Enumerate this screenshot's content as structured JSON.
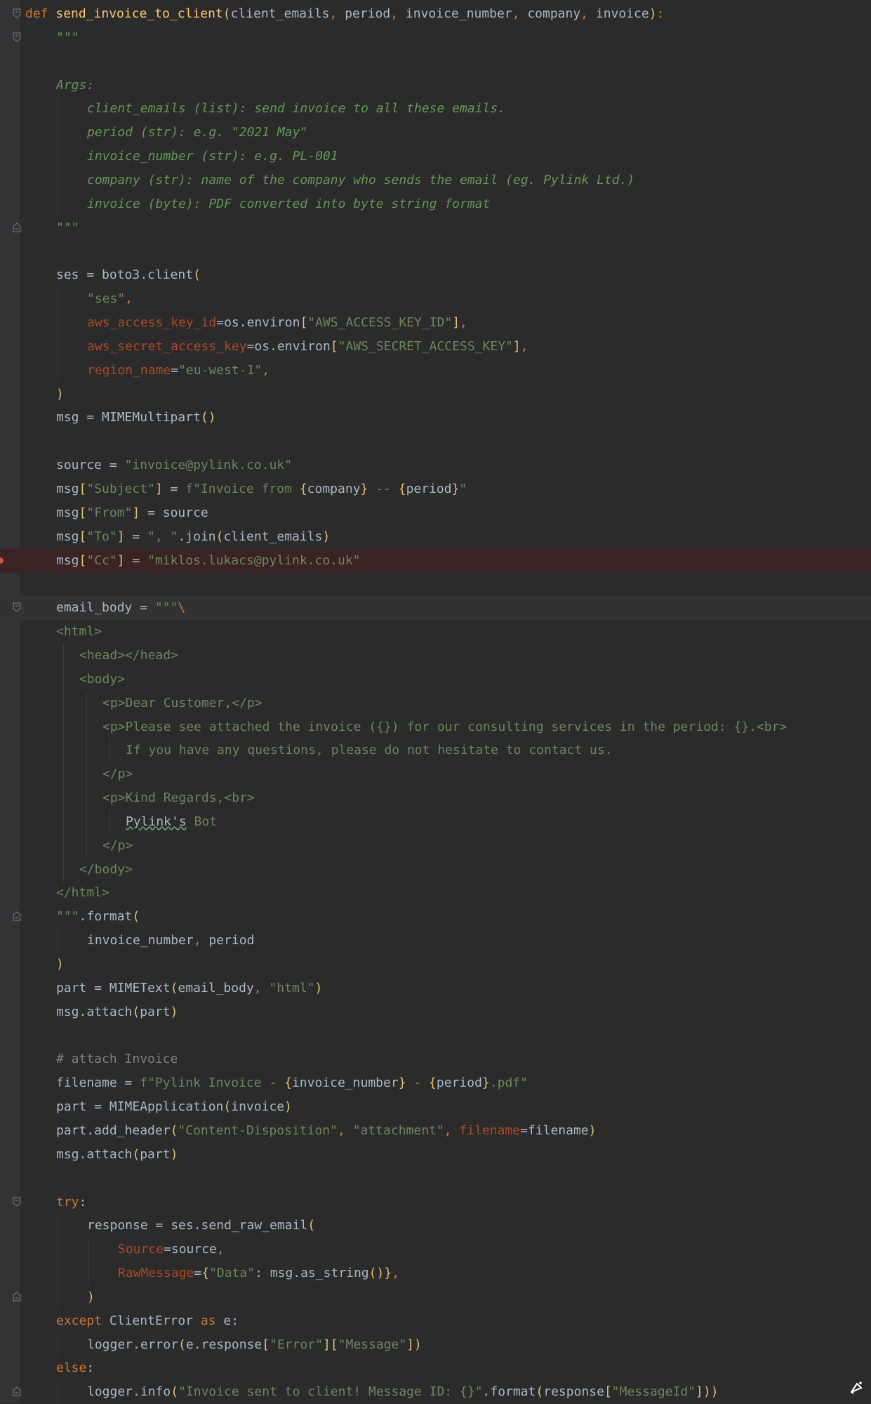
{
  "editor": {
    "language": "python",
    "breakpoint_line": 23,
    "current_line": 25,
    "colors": {
      "background": "#2b2b2b",
      "gutter": "#313335",
      "keyword": "#cc7832",
      "function": "#ffc66d",
      "string": "#6a8759",
      "docstring": "#629755",
      "parameter": "#aa4926",
      "comment": "#808080",
      "breakpoint": "#c75450"
    }
  },
  "code_lines": [
    {
      "indent": 0,
      "fold": "open",
      "tokens": [
        [
          "kw",
          "def "
        ],
        [
          "fn",
          "send_invoice_to_client"
        ],
        [
          "br",
          "("
        ],
        [
          "pl",
          "client_emails"
        ],
        [
          "kw",
          ", "
        ],
        [
          "pl",
          "period"
        ],
        [
          "kw",
          ", "
        ],
        [
          "pl",
          "invoice_number"
        ],
        [
          "kw",
          ", "
        ],
        [
          "pl",
          "company"
        ],
        [
          "kw",
          ", "
        ],
        [
          "pl",
          "invoice"
        ],
        [
          "br",
          ")"
        ],
        [
          "kw",
          ":"
        ]
      ]
    },
    {
      "indent": 1,
      "fold": "open",
      "tokens": [
        [
          "doc",
          "\"\"\""
        ]
      ]
    },
    {
      "indent": 0,
      "tokens": []
    },
    {
      "indent": 1,
      "tokens": [
        [
          "doc",
          "Args:"
        ]
      ]
    },
    {
      "indent": 2,
      "tokens": [
        [
          "doc",
          "client_emails (list): send invoice to all these emails."
        ]
      ]
    },
    {
      "indent": 2,
      "tokens": [
        [
          "doc",
          "period (str): e.g. \"2021 May\""
        ]
      ]
    },
    {
      "indent": 2,
      "tokens": [
        [
          "doc",
          "invoice_number (str): e.g. PL-001"
        ]
      ]
    },
    {
      "indent": 2,
      "tokens": [
        [
          "doc",
          "company (str): name of the company who sends the email (eg. Pylink Ltd.)"
        ]
      ]
    },
    {
      "indent": 2,
      "tokens": [
        [
          "doc",
          "invoice (byte): PDF converted into byte string format"
        ]
      ]
    },
    {
      "indent": 1,
      "fold": "close",
      "tokens": [
        [
          "doc",
          "\"\"\""
        ]
      ]
    },
    {
      "indent": 0,
      "tokens": []
    },
    {
      "indent": 1,
      "tokens": [
        [
          "pl",
          "ses = boto3.client"
        ],
        [
          "br",
          "("
        ]
      ]
    },
    {
      "indent": 2,
      "tokens": [
        [
          "str",
          "\"ses\""
        ],
        [
          "kw",
          ","
        ]
      ]
    },
    {
      "indent": 2,
      "tokens": [
        [
          "param",
          "aws_access_key_id"
        ],
        [
          "op",
          "=os.environ"
        ],
        [
          "br",
          "["
        ],
        [
          "str",
          "\"AWS_ACCESS_KEY_ID\""
        ],
        [
          "br",
          "]"
        ],
        [
          "kw",
          ","
        ]
      ]
    },
    {
      "indent": 2,
      "tokens": [
        [
          "param",
          "aws_secret_access_key"
        ],
        [
          "op",
          "=os.environ"
        ],
        [
          "br",
          "["
        ],
        [
          "str",
          "\"AWS_SECRET_ACCESS_KEY\""
        ],
        [
          "br",
          "]"
        ],
        [
          "kw",
          ","
        ]
      ]
    },
    {
      "indent": 2,
      "tokens": [
        [
          "param",
          "region_name"
        ],
        [
          "op",
          "="
        ],
        [
          "str",
          "\"eu-west-1\""
        ],
        [
          "kw",
          ","
        ]
      ]
    },
    {
      "indent": 1,
      "tokens": [
        [
          "br",
          ")"
        ]
      ]
    },
    {
      "indent": 1,
      "tokens": [
        [
          "pl",
          "msg = MIMEMultipart"
        ],
        [
          "br",
          "()"
        ]
      ]
    },
    {
      "indent": 0,
      "tokens": []
    },
    {
      "indent": 1,
      "tokens": [
        [
          "pl",
          "source = "
        ],
        [
          "str",
          "\"invoice@pylink.co.uk\""
        ]
      ]
    },
    {
      "indent": 1,
      "tokens": [
        [
          "pl",
          "msg"
        ],
        [
          "br",
          "["
        ],
        [
          "str",
          "\"Subject\""
        ],
        [
          "br",
          "]"
        ],
        [
          "pl",
          " = "
        ],
        [
          "str",
          "f\"Invoice from "
        ],
        [
          "br",
          "{"
        ],
        [
          "pl",
          "company"
        ],
        [
          "br",
          "}"
        ],
        [
          "str",
          " -- "
        ],
        [
          "br",
          "{"
        ],
        [
          "pl",
          "period"
        ],
        [
          "br",
          "}"
        ],
        [
          "str",
          "\""
        ]
      ]
    },
    {
      "indent": 1,
      "tokens": [
        [
          "pl",
          "msg"
        ],
        [
          "br",
          "["
        ],
        [
          "str",
          "\"From\""
        ],
        [
          "br",
          "]"
        ],
        [
          "pl",
          " = source"
        ]
      ]
    },
    {
      "indent": 1,
      "tokens": [
        [
          "pl",
          "msg"
        ],
        [
          "br",
          "["
        ],
        [
          "str",
          "\"To\""
        ],
        [
          "br",
          "]"
        ],
        [
          "pl",
          " = "
        ],
        [
          "str",
          "\", \""
        ],
        [
          "pl",
          ".join"
        ],
        [
          "br",
          "("
        ],
        [
          "pl",
          "client_emails"
        ],
        [
          "br",
          ")"
        ]
      ]
    },
    {
      "indent": 1,
      "tokens": [
        [
          "pl",
          "msg"
        ],
        [
          "br",
          "["
        ],
        [
          "str",
          "\"Cc\""
        ],
        [
          "br",
          "]"
        ],
        [
          "pl",
          " = "
        ],
        [
          "str",
          "\"miklos.lukacs@pylink.co.uk\""
        ]
      ]
    },
    {
      "indent": 0,
      "tokens": []
    },
    {
      "indent": 1,
      "fold": "open",
      "tokens": [
        [
          "pl",
          "email_body = "
        ],
        [
          "str",
          "\"\"\""
        ],
        [
          "esc",
          "\\"
        ]
      ]
    },
    {
      "indent": 1,
      "tokens": [
        [
          "str",
          "<html>"
        ]
      ]
    },
    {
      "indent": 1,
      "sub": 1,
      "tokens": [
        [
          "str",
          "<head></head>"
        ]
      ]
    },
    {
      "indent": 1,
      "sub": 1,
      "tokens": [
        [
          "str",
          "<body>"
        ]
      ]
    },
    {
      "indent": 1,
      "sub": 2,
      "tokens": [
        [
          "str",
          "<p>Dear Customer,</p>"
        ]
      ]
    },
    {
      "indent": 1,
      "sub": 2,
      "tokens": [
        [
          "str",
          "<p>Please see attached the invoice ({}) for our consulting services in the period: {}.<br>"
        ]
      ]
    },
    {
      "indent": 1,
      "sub": 3,
      "tokens": [
        [
          "str",
          "If you have any questions, please do not hesitate to contact us."
        ]
      ]
    },
    {
      "indent": 1,
      "sub": 2,
      "tokens": [
        [
          "str",
          "</p>"
        ]
      ]
    },
    {
      "indent": 1,
      "sub": 2,
      "tokens": [
        [
          "str",
          "<p>Kind Regards,<br>"
        ]
      ]
    },
    {
      "indent": 1,
      "sub": 3,
      "tokens": [
        [
          "typo",
          "Pylink's"
        ],
        [
          "str",
          " Bot"
        ]
      ]
    },
    {
      "indent": 1,
      "sub": 2,
      "tokens": [
        [
          "str",
          "</p>"
        ]
      ]
    },
    {
      "indent": 1,
      "sub": 1,
      "tokens": [
        [
          "str",
          "</body>"
        ]
      ]
    },
    {
      "indent": 1,
      "tokens": [
        [
          "str",
          "</html>"
        ]
      ]
    },
    {
      "indent": 1,
      "fold": "close",
      "tokens": [
        [
          "str",
          "\"\"\""
        ],
        [
          "pl",
          ".format"
        ],
        [
          "br",
          "("
        ]
      ]
    },
    {
      "indent": 2,
      "tokens": [
        [
          "pl",
          "invoice_number"
        ],
        [
          "kw",
          ", "
        ],
        [
          "pl",
          "period"
        ]
      ]
    },
    {
      "indent": 1,
      "tokens": [
        [
          "br",
          ")"
        ]
      ]
    },
    {
      "indent": 1,
      "tokens": [
        [
          "pl",
          "part = MIMEText"
        ],
        [
          "br",
          "("
        ],
        [
          "pl",
          "email_body"
        ],
        [
          "kw",
          ", "
        ],
        [
          "str",
          "\"html\""
        ],
        [
          "br",
          ")"
        ]
      ]
    },
    {
      "indent": 1,
      "tokens": [
        [
          "pl",
          "msg.attach"
        ],
        [
          "br",
          "("
        ],
        [
          "pl",
          "part"
        ],
        [
          "br",
          ")"
        ]
      ]
    },
    {
      "indent": 0,
      "tokens": []
    },
    {
      "indent": 1,
      "tokens": [
        [
          "cm",
          "# attach Invoice"
        ]
      ]
    },
    {
      "indent": 1,
      "tokens": [
        [
          "pl",
          "filename = "
        ],
        [
          "str",
          "f\"Pylink Invoice - "
        ],
        [
          "br",
          "{"
        ],
        [
          "pl",
          "invoice_number"
        ],
        [
          "br",
          "}"
        ],
        [
          "str",
          " - "
        ],
        [
          "br",
          "{"
        ],
        [
          "pl",
          "period"
        ],
        [
          "br",
          "}"
        ],
        [
          "str",
          ".pdf\""
        ]
      ]
    },
    {
      "indent": 1,
      "tokens": [
        [
          "pl",
          "part = MIMEApplication"
        ],
        [
          "br",
          "("
        ],
        [
          "pl",
          "invoice"
        ],
        [
          "br",
          ")"
        ]
      ]
    },
    {
      "indent": 1,
      "tokens": [
        [
          "pl",
          "part.add_header"
        ],
        [
          "br",
          "("
        ],
        [
          "str",
          "\"Content-Disposition\""
        ],
        [
          "kw",
          ", "
        ],
        [
          "str",
          "\"attachment\""
        ],
        [
          "kw",
          ", "
        ],
        [
          "param",
          "filename"
        ],
        [
          "op",
          "=filename"
        ],
        [
          "br",
          ")"
        ]
      ]
    },
    {
      "indent": 1,
      "tokens": [
        [
          "pl",
          "msg.attach"
        ],
        [
          "br",
          "("
        ],
        [
          "pl",
          "part"
        ],
        [
          "br",
          ")"
        ]
      ]
    },
    {
      "indent": 0,
      "tokens": []
    },
    {
      "indent": 1,
      "fold": "open",
      "tokens": [
        [
          "kw",
          "try"
        ],
        [
          "pl",
          ":"
        ]
      ]
    },
    {
      "indent": 2,
      "tokens": [
        [
          "pl",
          "response = ses.send_raw_email"
        ],
        [
          "br",
          "("
        ]
      ]
    },
    {
      "indent": 3,
      "tokens": [
        [
          "param",
          "Source"
        ],
        [
          "op",
          "=source"
        ],
        [
          "kw",
          ","
        ]
      ]
    },
    {
      "indent": 3,
      "tokens": [
        [
          "param",
          "RawMessage"
        ],
        [
          "op",
          "="
        ],
        [
          "br",
          "{"
        ],
        [
          "str",
          "\"Data\""
        ],
        [
          "pl",
          ": msg.as_string"
        ],
        [
          "br",
          "()"
        ],
        [
          "br",
          "}"
        ],
        [
          "kw",
          ","
        ]
      ]
    },
    {
      "indent": 2,
      "fold": "close",
      "tokens": [
        [
          "br",
          ")"
        ]
      ]
    },
    {
      "indent": 1,
      "tokens": [
        [
          "kw",
          "except "
        ],
        [
          "pl",
          "ClientError "
        ],
        [
          "kw",
          "as "
        ],
        [
          "pl",
          "e:"
        ]
      ]
    },
    {
      "indent": 2,
      "tokens": [
        [
          "pl",
          "logger.error"
        ],
        [
          "br",
          "("
        ],
        [
          "pl",
          "e.response"
        ],
        [
          "br",
          "["
        ],
        [
          "str",
          "\"Error\""
        ],
        [
          "br",
          "]["
        ],
        [
          "str",
          "\"Message\""
        ],
        [
          "br",
          "])"
        ]
      ]
    },
    {
      "indent": 1,
      "tokens": [
        [
          "kw",
          "else"
        ],
        [
          "pl",
          ":"
        ]
      ]
    },
    {
      "indent": 2,
      "fold": "close",
      "tokens": [
        [
          "pl",
          "logger.info"
        ],
        [
          "br",
          "("
        ],
        [
          "str",
          "\"Invoice sent to client! Message ID: {}\""
        ],
        [
          "pl",
          ".format"
        ],
        [
          "br",
          "("
        ],
        [
          "pl",
          "response"
        ],
        [
          "br",
          "["
        ],
        [
          "str",
          "\"MessageId\""
        ],
        [
          "br",
          "])"
        ],
        [
          "br",
          ")"
        ]
      ]
    }
  ],
  "icons": {
    "fold_open": "fold-open-icon",
    "fold_close": "fold-close-icon",
    "breakpoint": "breakpoint-icon",
    "agent": "ai-assistant-icon"
  }
}
